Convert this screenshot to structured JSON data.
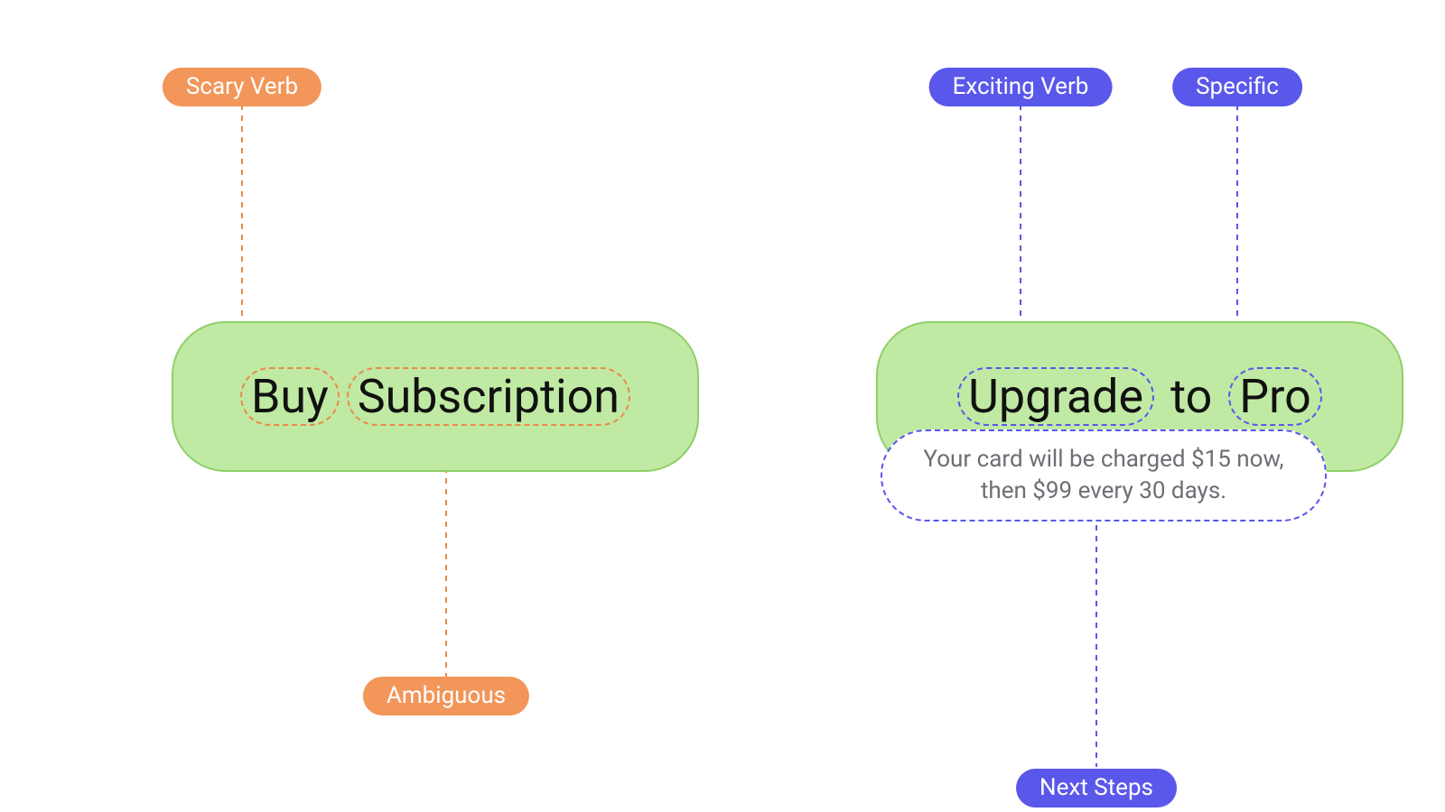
{
  "left": {
    "tag_top": {
      "label": "Scary Verb",
      "color": "orange"
    },
    "tag_bottom": {
      "label": "Ambiguous",
      "color": "orange"
    },
    "cta_words": [
      "Buy",
      "Subscription"
    ]
  },
  "right": {
    "tag_top_1": {
      "label": "Exciting Verb",
      "color": "purple"
    },
    "tag_top_2": {
      "label": "Specific",
      "color": "purple"
    },
    "tag_bottom": {
      "label": "Next Steps",
      "color": "purple"
    },
    "cta_words": [
      "Upgrade",
      "to",
      "Pro"
    ],
    "subtext_line1": "Your card will be charged $15 now,",
    "subtext_line2": "then $99 every 30 days."
  },
  "colors": {
    "orange": "#f2965a",
    "purple": "#5a57eb",
    "green_bg": "#c0eaa3",
    "green_border": "#8fcf68"
  }
}
